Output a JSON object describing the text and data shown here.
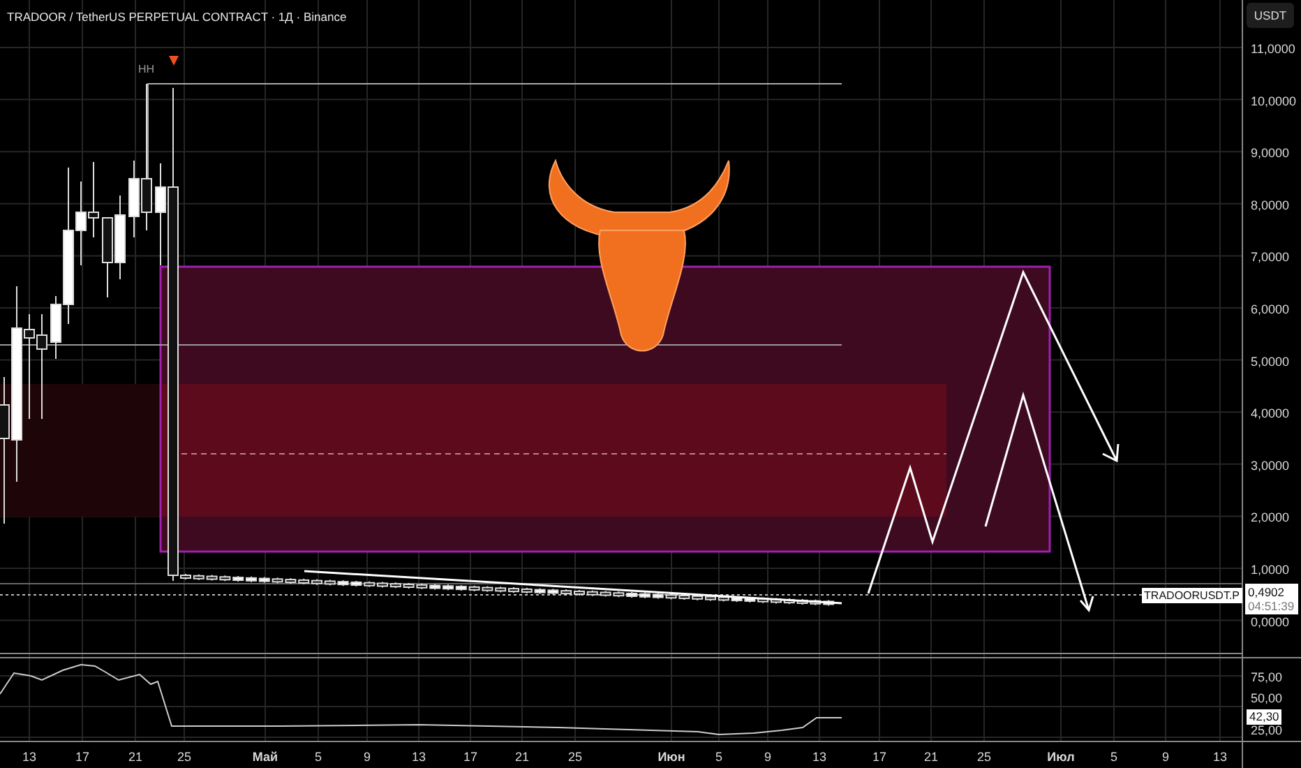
{
  "header": {
    "title": "TRADOOR / TetherUS PERPETUAL CONTRACT · 1Д · Binance"
  },
  "currency": "USDT",
  "chart_marks": {
    "high_label": "HH"
  },
  "price_axis": [
    "11,0000",
    "10,0000",
    "9,0000",
    "8,0000",
    "7,0000",
    "6,0000",
    "5,0000",
    "4,0000",
    "3,0000",
    "2,0000",
    "1,0000",
    "0,0000"
  ],
  "price_tag": {
    "symbol": "TRADOORUSDT.P",
    "price": "0,4902",
    "countdown": "04:51:39"
  },
  "indicator": {
    "axis": [
      "75,00",
      "50,00",
      "25,00"
    ],
    "value": "42,30"
  },
  "time_axis": [
    "13",
    "17",
    "21",
    "25",
    "Май",
    "5",
    "9",
    "13",
    "17",
    "21",
    "25",
    "Июн",
    "5",
    "9",
    "13",
    "17",
    "21",
    "25",
    "Июл",
    "5",
    "9",
    "13"
  ]
}
